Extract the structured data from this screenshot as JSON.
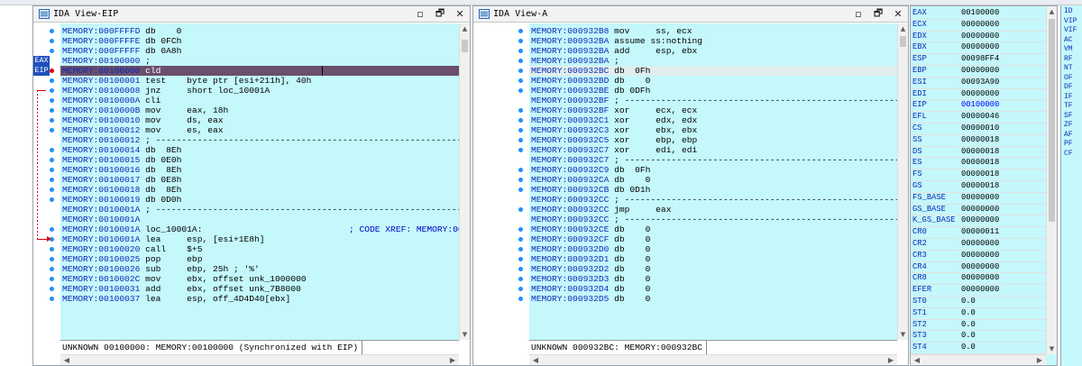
{
  "left_pane": {
    "title": "IDA View-EIP",
    "minimize_glyph": "▫",
    "float_glyph": "🗗",
    "close_glyph": "✕",
    "eip_label": "EAX",
    "eip_label2": "EIP",
    "lines": [
      {
        "addr": "MEMORY:000FFFFD",
        "text": " db    0"
      },
      {
        "addr": "MEMORY:000FFFFE",
        "text": " db 0FCh"
      },
      {
        "addr": "MEMORY:000FFFFF",
        "text": " db 0A8h"
      },
      {
        "addr": "MEMORY:00100000",
        "text": " ;"
      },
      {
        "addr": "MEMORY:00100000",
        "text": " cld"
      },
      {
        "addr": "MEMORY:00100001",
        "text": " test    byte ptr [esi+211h], 40h"
      },
      {
        "addr": "MEMORY:00100008",
        "text": " jnz     short loc_10001A"
      },
      {
        "addr": "MEMORY:0010000A",
        "text": " cli"
      },
      {
        "addr": "MEMORY:0010000B",
        "text": " mov     eax, 18h"
      },
      {
        "addr": "MEMORY:00100010",
        "text": " mov     ds, eax"
      },
      {
        "addr": "MEMORY:00100012",
        "text": " mov     es, eax"
      },
      {
        "addr": "MEMORY:00100012",
        "text": " ; ---------------------------------------------------------------------------"
      },
      {
        "addr": "MEMORY:00100014",
        "text": " db  8Eh"
      },
      {
        "addr": "MEMORY:00100015",
        "text": " db 0E0h"
      },
      {
        "addr": "MEMORY:00100016",
        "text": " db  8Eh"
      },
      {
        "addr": "MEMORY:00100017",
        "text": " db 0E8h"
      },
      {
        "addr": "MEMORY:00100018",
        "text": " db  8Eh"
      },
      {
        "addr": "MEMORY:00100019",
        "text": " db 0D0h"
      },
      {
        "addr": "MEMORY:0010001A",
        "text": " ; ---------------------------------------------------------------------------"
      },
      {
        "addr": "MEMORY:0010001A",
        "text": ""
      },
      {
        "addr": "MEMORY:0010001A",
        "text": " loc_10001A:"
      },
      {
        "addr": "MEMORY:0010001A",
        "text": " lea     esp, [esi+1E8h]"
      },
      {
        "addr": "MEMORY:00100020",
        "text": " call    $+5"
      },
      {
        "addr": "MEMORY:00100025",
        "text": " pop     ebp"
      },
      {
        "addr": "MEMORY:00100026",
        "text": " sub     ebp, 25h ; '%'"
      },
      {
        "addr": "MEMORY:0010002C",
        "text": " mov     ebx, offset unk_1000000"
      },
      {
        "addr": "MEMORY:00100031",
        "text": " add     ebx, offset unk_7B8000"
      },
      {
        "addr": "MEMORY:00100037",
        "text": " lea     esp, off_4D4D40[ebx]"
      }
    ],
    "xref_comment": "; CODE XREF: MEMORY:00",
    "status": "UNKNOWN 00100000: MEMORY:00100000 (Synchronized with EIP)"
  },
  "right_pane": {
    "title": "IDA View-A",
    "minimize_glyph": "▫",
    "float_glyph": "🗗",
    "close_glyph": "✕",
    "lines": [
      {
        "addr": "MEMORY:000932B8",
        "text": " mov     ss, ecx"
      },
      {
        "addr": "MEMORY:000932BA",
        "text": " assume ss:nothing"
      },
      {
        "addr": "MEMORY:000932BA",
        "text": " add     esp, ebx"
      },
      {
        "addr": "MEMORY:000932BA",
        "text": " ;"
      },
      {
        "addr": "MEMORY:000932BC",
        "text": " db  0Fh"
      },
      {
        "addr": "MEMORY:000932BD",
        "text": " db    0"
      },
      {
        "addr": "MEMORY:000932BE",
        "text": " db 0DFh"
      },
      {
        "addr": "MEMORY:000932BF",
        "text": " ; ---------------------------------------------------------------------------"
      },
      {
        "addr": "MEMORY:000932BF",
        "text": " xor     ecx, ecx"
      },
      {
        "addr": "MEMORY:000932C1",
        "text": " xor     edx, edx"
      },
      {
        "addr": "MEMORY:000932C3",
        "text": " xor     ebx, ebx"
      },
      {
        "addr": "MEMORY:000932C5",
        "text": " xor     ebp, ebp"
      },
      {
        "addr": "MEMORY:000932C7",
        "text": " xor     edi, edi"
      },
      {
        "addr": "MEMORY:000932C7",
        "text": " ; ---------------------------------------------------------------------------"
      },
      {
        "addr": "MEMORY:000932C9",
        "text": " db  0Fh"
      },
      {
        "addr": "MEMORY:000932CA",
        "text": " db    0"
      },
      {
        "addr": "MEMORY:000932CB",
        "text": " db 0D1h"
      },
      {
        "addr": "MEMORY:000932CC",
        "text": " ; ---------------------------------------------------------------------------"
      },
      {
        "addr": "MEMORY:000932CC",
        "text": " jmp     eax"
      },
      {
        "addr": "MEMORY:000932CC",
        "text": " ; ---------------------------------------------------------------------------"
      },
      {
        "addr": "MEMORY:000932CE",
        "text": " db    0"
      },
      {
        "addr": "MEMORY:000932CF",
        "text": " db    0"
      },
      {
        "addr": "MEMORY:000932D0",
        "text": " db    0"
      },
      {
        "addr": "MEMORY:000932D1",
        "text": " db    0"
      },
      {
        "addr": "MEMORY:000932D2",
        "text": " db    0"
      },
      {
        "addr": "MEMORY:000932D3",
        "text": " db    0"
      },
      {
        "addr": "MEMORY:000932D4",
        "text": " db    0"
      },
      {
        "addr": "MEMORY:000932D5",
        "text": " db    0"
      }
    ],
    "status": "UNKNOWN 000932BC: MEMORY:000932BC"
  },
  "registers": [
    {
      "name": "EAX",
      "value": "00100000"
    },
    {
      "name": "ECX",
      "value": "00000000"
    },
    {
      "name": "EDX",
      "value": "00000000"
    },
    {
      "name": "EBX",
      "value": "00000000"
    },
    {
      "name": "ESP",
      "value": "00098FF4"
    },
    {
      "name": "EBP",
      "value": "00000000"
    },
    {
      "name": "ESI",
      "value": "00093A90"
    },
    {
      "name": "EDI",
      "value": "00000000"
    },
    {
      "name": "EIP",
      "value": "00100000"
    },
    {
      "name": "EFL",
      "value": "00000046"
    },
    {
      "name": "CS",
      "value": "00000010"
    },
    {
      "name": "SS",
      "value": "00000018"
    },
    {
      "name": "DS",
      "value": "00000018"
    },
    {
      "name": "ES",
      "value": "00000018"
    },
    {
      "name": "FS",
      "value": "00000018"
    },
    {
      "name": "GS",
      "value": "00000018"
    },
    {
      "name": "FS_BASE",
      "value": "00000000"
    },
    {
      "name": "GS_BASE",
      "value": "00000000"
    },
    {
      "name": "K_GS_BASE",
      "value": "00000000"
    },
    {
      "name": "CR0",
      "value": "00000011"
    },
    {
      "name": "CR2",
      "value": "00000000"
    },
    {
      "name": "CR3",
      "value": "00000000"
    },
    {
      "name": "CR4",
      "value": "00000000"
    },
    {
      "name": "CR8",
      "value": "00000000"
    },
    {
      "name": "EFER",
      "value": "00000000"
    },
    {
      "name": "ST0",
      "value": "0.0"
    },
    {
      "name": "ST1",
      "value": "0.0"
    },
    {
      "name": "ST2",
      "value": "0.0"
    },
    {
      "name": "ST3",
      "value": "0.0"
    },
    {
      "name": "ST4",
      "value": "0.0"
    }
  ],
  "flags": [
    "ID",
    "VIP",
    "VIF",
    "AC",
    "VM",
    "RF",
    "NT",
    "OF",
    "DF",
    "IF",
    "TF",
    "SF",
    "ZF",
    "AF",
    "PF",
    "CF"
  ],
  "colors": {
    "code_bg": "#c4f8fb",
    "eip_highlight": "#6b4f6c",
    "address": "#0c2bb8",
    "breakpoint_dot": "#1e90ff",
    "arrow": "#e00000"
  }
}
